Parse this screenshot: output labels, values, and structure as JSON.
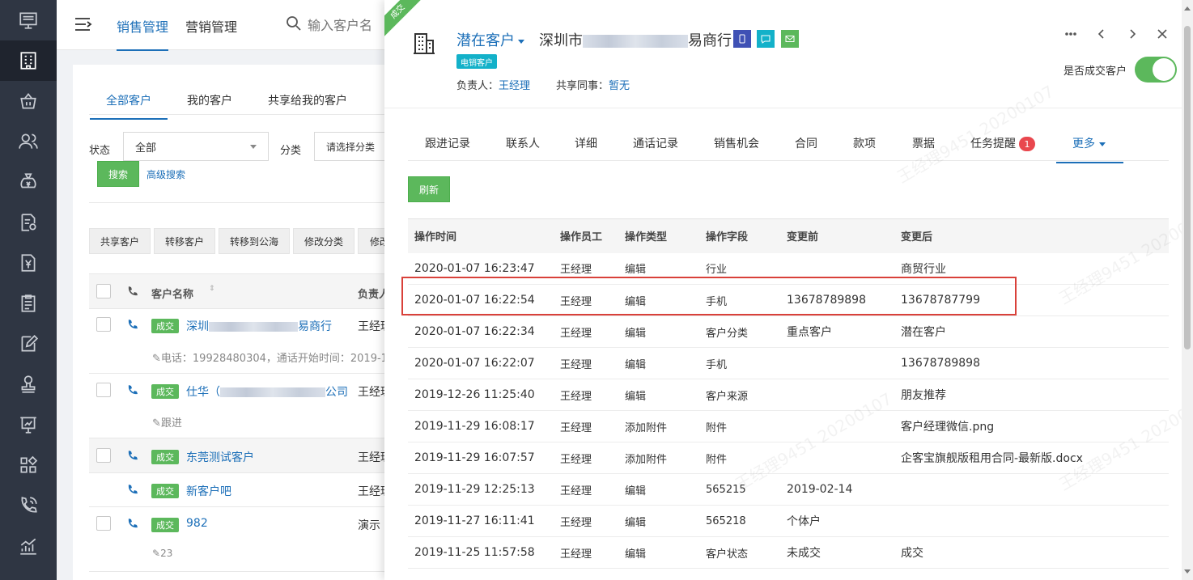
{
  "sidebar": {
    "items": [
      {
        "icon": "monitor-icon"
      },
      {
        "icon": "building-icon",
        "active": true
      },
      {
        "icon": "basket-icon"
      },
      {
        "icon": "users-icon"
      },
      {
        "icon": "money-bag-icon"
      },
      {
        "icon": "document-gear-icon"
      },
      {
        "icon": "yen-document-icon"
      },
      {
        "icon": "clipboard-icon"
      },
      {
        "icon": "edit-note-icon"
      },
      {
        "icon": "stamp-icon"
      },
      {
        "icon": "presentation-chart-icon"
      },
      {
        "icon": "apps-grid-icon"
      },
      {
        "icon": "phone-call-icon"
      },
      {
        "icon": "trend-chart-icon"
      }
    ]
  },
  "topbar": {
    "tabs": [
      "销售管理",
      "营销管理"
    ],
    "search_placeholder": "输入客户名"
  },
  "list": {
    "tabs": [
      "全部客户",
      "我的客户",
      "共享给我的客户"
    ],
    "filters": {
      "status_label": "状态",
      "status_value": "全部",
      "category_label": "分类",
      "category_placeholder": "请选择分类"
    },
    "search_button": "搜索",
    "advanced_search": "高级搜索",
    "actions": [
      "共享客户",
      "转移客户",
      "转移到公海",
      "修改分类",
      "修改"
    ],
    "header": {
      "name": "客户名称",
      "owner": "负责人"
    },
    "rows": [
      {
        "badge": "成交",
        "name_prefix": "深圳",
        "name_suffix": "易商行",
        "owner": "王经理",
        "note": "电话：19928480304，通话开始时间：2019-1"
      },
      {
        "badge": "成交",
        "name_prefix": "仕华（",
        "name_suffix": "公司",
        "owner": "王经理",
        "note": "跟进"
      },
      {
        "badge": "成交",
        "name": "东莞测试客户",
        "owner": "王经理"
      },
      {
        "badge": "成交",
        "name": "新客户吧",
        "owner": "王经理"
      },
      {
        "badge": "成交",
        "name": "982",
        "owner": "演示",
        "note": "23"
      }
    ]
  },
  "detail": {
    "ribbon": "成交",
    "status": "潜在客户",
    "company_prefix": "深圳市",
    "company_suffix": "易商行",
    "tag": "电销客户",
    "owner_label": "负责人：",
    "owner_value": "王经理",
    "share_label": "共享同事：",
    "share_value": "暂无",
    "deal_toggle_label": "是否成交客户",
    "deal_toggle_on": true,
    "tabs": [
      "跟进记录",
      "联系人",
      "详细",
      "通话记录",
      "销售机会",
      "合同",
      "款项",
      "票据",
      "任务提醒",
      "更多"
    ],
    "task_badge": "1",
    "refresh_button": "刷新",
    "columns": [
      "操作时间",
      "操作员工",
      "操作类型",
      "操作字段",
      "变更前",
      "变更后"
    ],
    "rows": [
      [
        "2020-01-07 16:23:47",
        "王经理",
        "编辑",
        "行业",
        "",
        "商贸行业"
      ],
      [
        "2020-01-07 16:22:54",
        "王经理",
        "编辑",
        "手机",
        "13678789898",
        "13678787799"
      ],
      [
        "2020-01-07 16:22:34",
        "王经理",
        "编辑",
        "客户分类",
        "重点客户",
        "潜在客户"
      ],
      [
        "2020-01-07 16:22:07",
        "王经理",
        "编辑",
        "手机",
        "",
        "13678789898"
      ],
      [
        "2019-12-26 11:25:40",
        "王经理",
        "编辑",
        "客户来源",
        "",
        "朋友推荐"
      ],
      [
        "2019-11-29 16:08:17",
        "王经理",
        "添加附件",
        "附件",
        "",
        "客户经理微信.png"
      ],
      [
        "2019-11-29 16:07:57",
        "王经理",
        "添加附件",
        "附件",
        "",
        "企客宝旗舰版租用合同-最新版.docx"
      ],
      [
        "2019-11-29 12:25:13",
        "王经理",
        "编辑",
        "565215",
        "2019-02-14",
        ""
      ],
      [
        "2019-11-27 16:11:41",
        "王经理",
        "编辑",
        "565218",
        "个体户",
        ""
      ],
      [
        "2019-11-25 11:57:58",
        "王经理",
        "编辑",
        "客户状态",
        "未成交",
        "成交"
      ]
    ],
    "highlighted_row_index": 1,
    "watermark": "王经理9451 20200107"
  },
  "colors": {
    "accent": "#1c6fb8",
    "success": "#5cb85c",
    "sidebar": "#2f3643",
    "highlight_border": "#d9413a",
    "tag_cyan": "#13b1c9"
  }
}
